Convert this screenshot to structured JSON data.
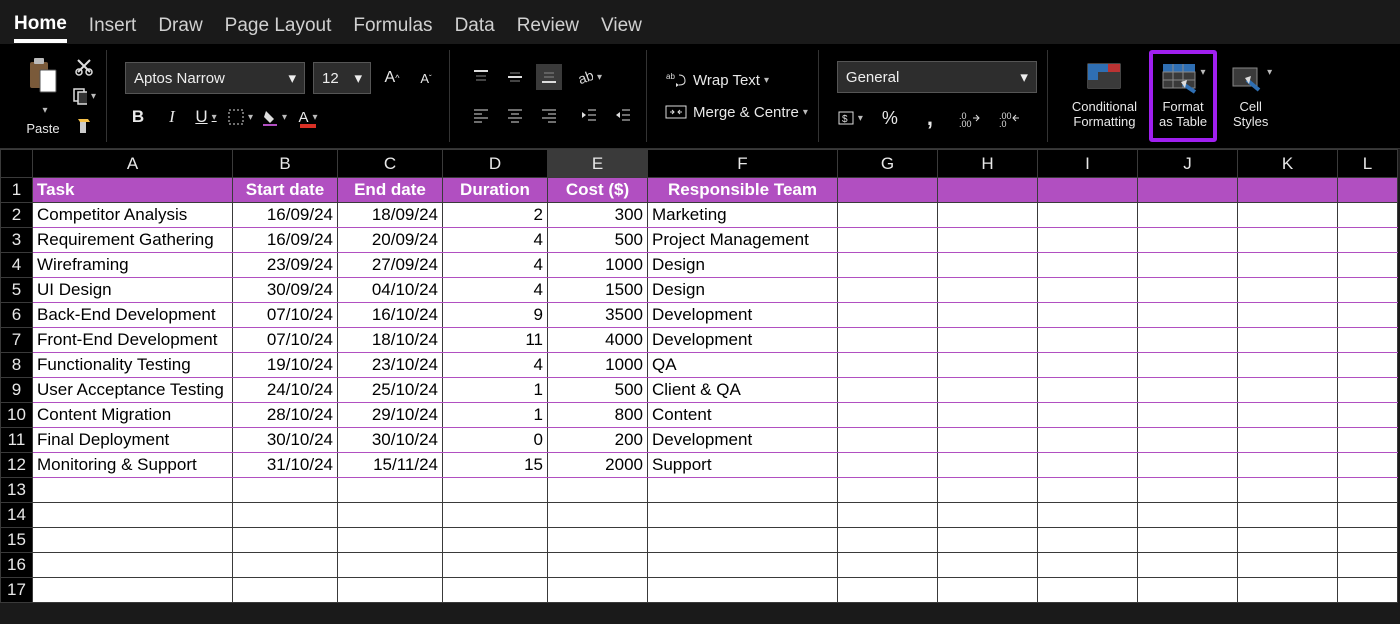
{
  "tabs": [
    "Home",
    "Insert",
    "Draw",
    "Page Layout",
    "Formulas",
    "Data",
    "Review",
    "View"
  ],
  "active_tab": "Home",
  "ribbon": {
    "paste_label": "Paste",
    "font_name": "Aptos Narrow",
    "font_size": "12",
    "wrap_text": "Wrap Text",
    "merge_centre": "Merge & Centre",
    "number_format": "General",
    "conditional_formatting": "Conditional\nFormatting",
    "format_as_table": "Format\nas Table",
    "cell_styles": "Cell\nStyles"
  },
  "columns": [
    "A",
    "B",
    "C",
    "D",
    "E",
    "F",
    "G",
    "H",
    "I",
    "J",
    "K",
    "L"
  ],
  "selected_column": "E",
  "total_rows": 17,
  "headers": {
    "task": "Task",
    "start": "Start date",
    "end": "End date",
    "duration": "Duration",
    "cost": "Cost ($)",
    "team": "Responsible Team"
  },
  "rows": [
    {
      "task": "Competitor Analysis",
      "start": "16/09/24",
      "end": "18/09/24",
      "duration": "2",
      "cost": "300",
      "team": "Marketing"
    },
    {
      "task": "Requirement Gathering",
      "start": "16/09/24",
      "end": "20/09/24",
      "duration": "4",
      "cost": "500",
      "team": "Project Management"
    },
    {
      "task": "Wireframing",
      "start": "23/09/24",
      "end": "27/09/24",
      "duration": "4",
      "cost": "1000",
      "team": "Design"
    },
    {
      "task": "UI Design",
      "start": "30/09/24",
      "end": "04/10/24",
      "duration": "4",
      "cost": "1500",
      "team": "Design"
    },
    {
      "task": "Back-End Development",
      "start": "07/10/24",
      "end": "16/10/24",
      "duration": "9",
      "cost": "3500",
      "team": "Development"
    },
    {
      "task": "Front-End Development",
      "start": "07/10/24",
      "end": "18/10/24",
      "duration": "11",
      "cost": "4000",
      "team": "Development"
    },
    {
      "task": "Functionality Testing",
      "start": "19/10/24",
      "end": "23/10/24",
      "duration": "4",
      "cost": "1000",
      "team": "QA"
    },
    {
      "task": "User Acceptance Testing",
      "start": "24/10/24",
      "end": "25/10/24",
      "duration": "1",
      "cost": "500",
      "team": "Client & QA"
    },
    {
      "task": "Content Migration",
      "start": "28/10/24",
      "end": "29/10/24",
      "duration": "1",
      "cost": "800",
      "team": "Content"
    },
    {
      "task": "Final Deployment",
      "start": "30/10/24",
      "end": "30/10/24",
      "duration": "0",
      "cost": "200",
      "team": "Development"
    },
    {
      "task": "Monitoring & Support",
      "start": "31/10/24",
      "end": "15/11/24",
      "duration": "15",
      "cost": "2000",
      "team": "Support"
    }
  ]
}
